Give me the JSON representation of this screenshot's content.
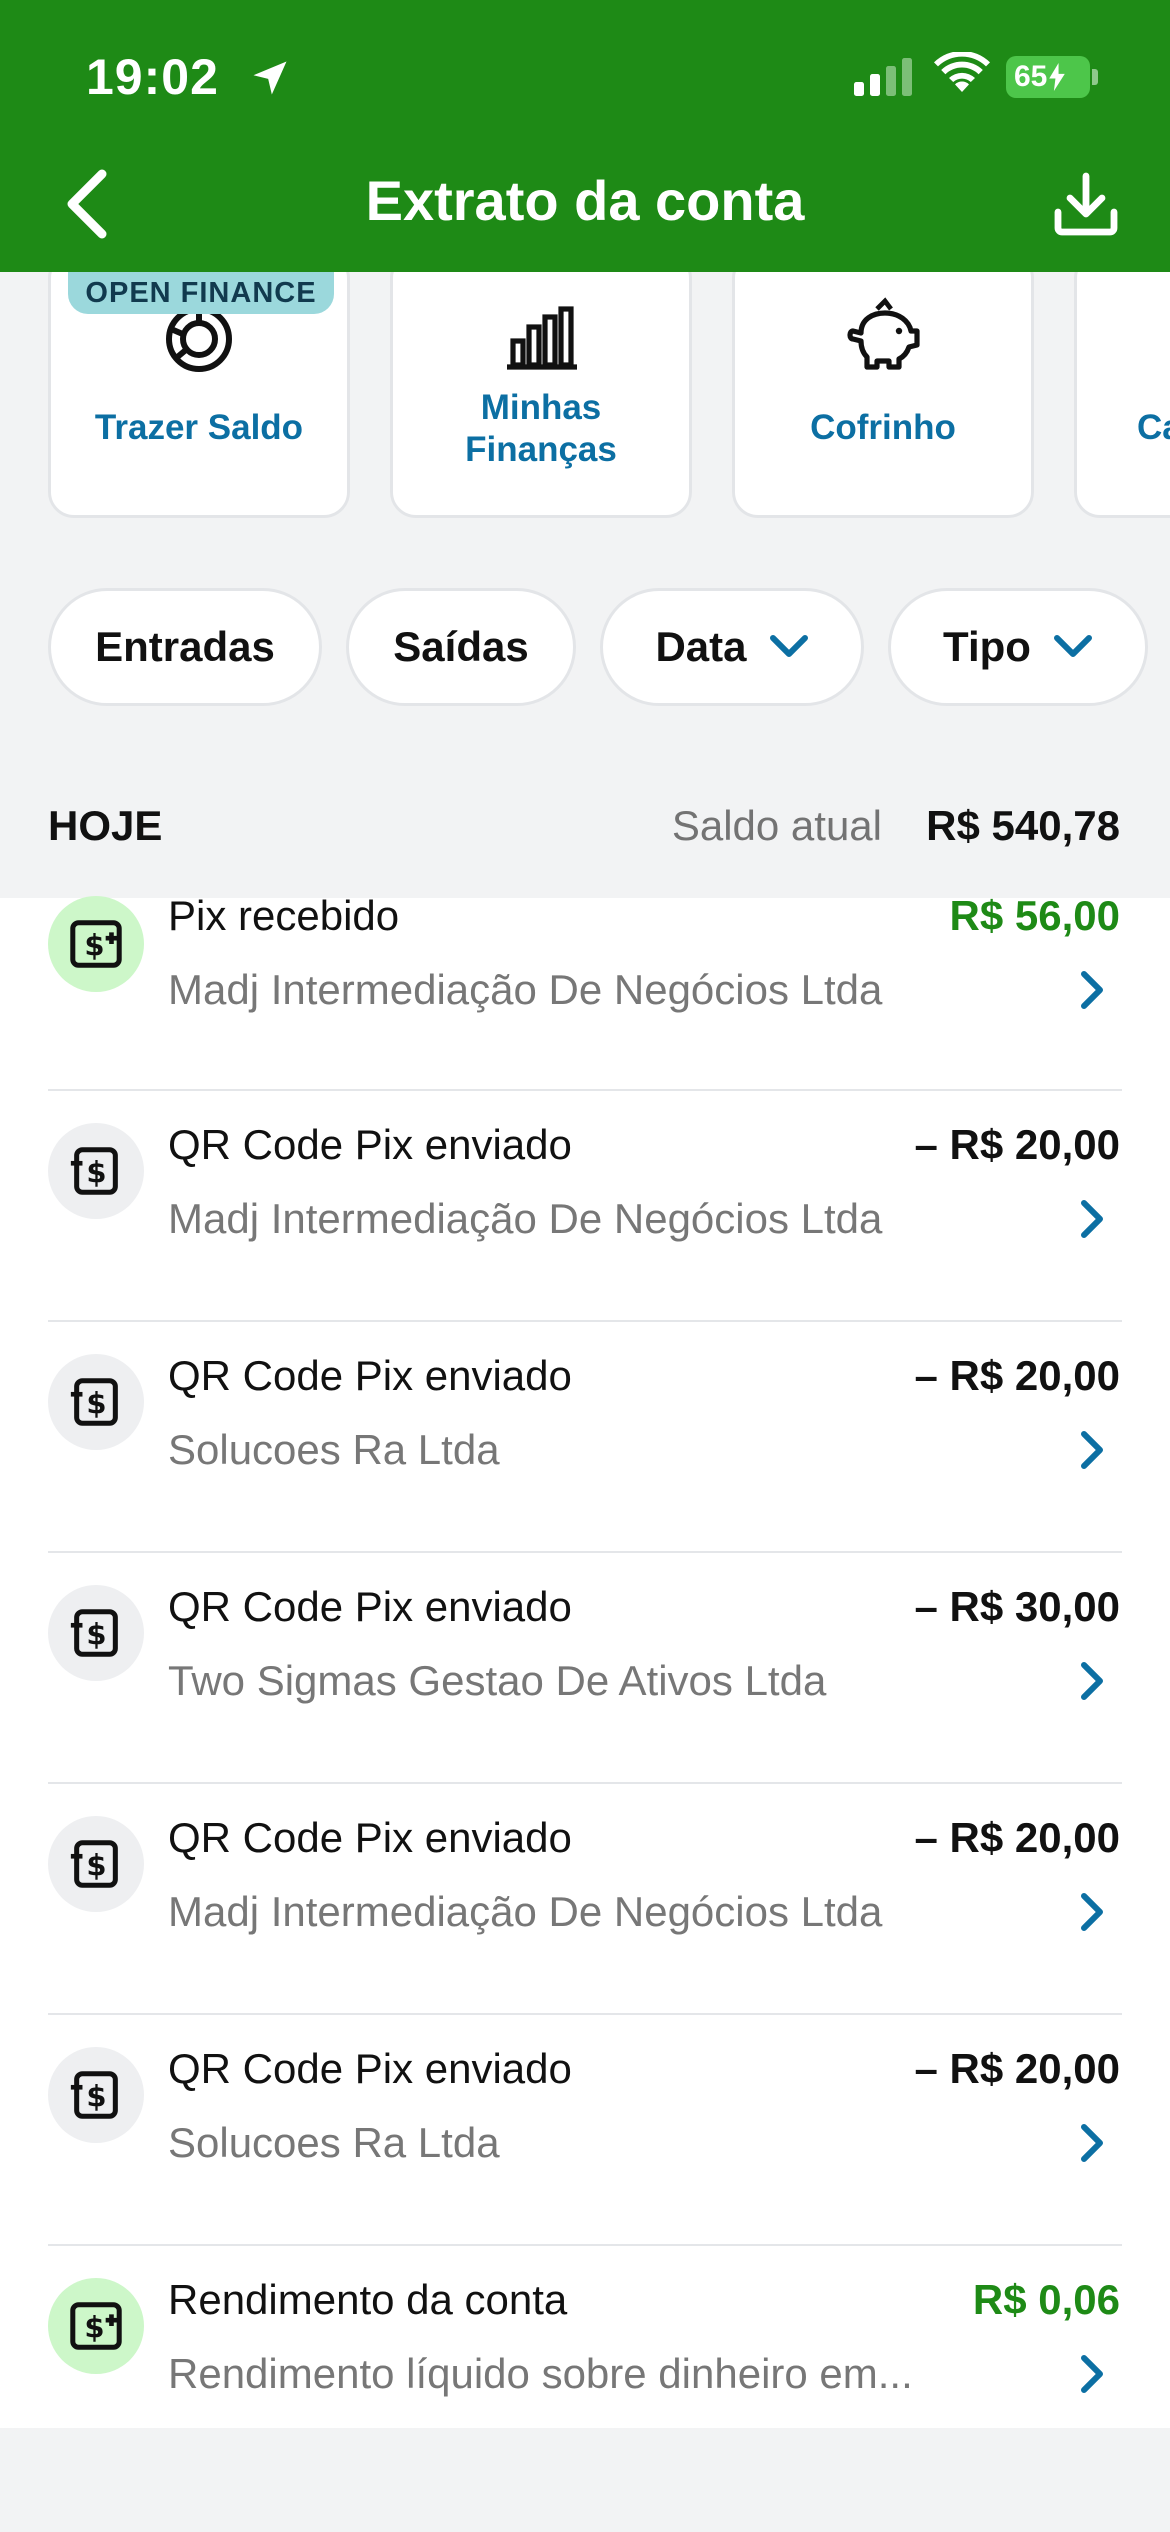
{
  "status_bar": {
    "time": "19:02",
    "battery": "65"
  },
  "header": {
    "title": "Extrato da conta"
  },
  "cards": [
    {
      "label": "Trazer Saldo",
      "badge": "OPEN FINANCE",
      "icon": "pie-chart-icon"
    },
    {
      "label_line1": "Minhas",
      "label_line2": "Finanças",
      "icon": "bar-chart-icon"
    },
    {
      "label": "Cofrinho",
      "icon": "piggy-bank-icon"
    },
    {
      "label": "Ca",
      "icon": ""
    }
  ],
  "filters": [
    {
      "label": "Entradas"
    },
    {
      "label": "Saídas"
    },
    {
      "label": "Data"
    },
    {
      "label": "Tipo"
    }
  ],
  "section": {
    "title": "HOJE",
    "balance_label": "Saldo atual",
    "balance_value": "R$ 540,78"
  },
  "transactions": [
    {
      "title": "Pix recebido",
      "subtitle": "Madj Intermediação De Negócios Ltda",
      "amount": "R$ 56,00",
      "direction": "in"
    },
    {
      "title": "QR Code Pix enviado",
      "subtitle": "Madj Intermediação De Negócios Ltda",
      "amount": "– R$ 20,00",
      "direction": "out"
    },
    {
      "title": "QR Code Pix enviado",
      "subtitle": "Solucoes Ra Ltda",
      "amount": "– R$ 20,00",
      "direction": "out"
    },
    {
      "title": "QR Code Pix enviado",
      "subtitle": "Two Sigmas Gestao De Ativos Ltda",
      "amount": "– R$ 30,00",
      "direction": "out"
    },
    {
      "title": "QR Code Pix enviado",
      "subtitle": "Madj Intermediação De Negócios Ltda",
      "amount": "– R$ 20,00",
      "direction": "out"
    },
    {
      "title": "QR Code Pix enviado",
      "subtitle": "Solucoes Ra Ltda",
      "amount": "– R$ 20,00",
      "direction": "out"
    },
    {
      "title": "Rendimento da conta",
      "subtitle": "Rendimento líquido sobre dinheiro em...",
      "amount": "R$ 0,06",
      "direction": "in"
    }
  ],
  "colors": {
    "brand_green": "#1e8a16",
    "link_blue": "#0c6fa3",
    "positive_green": "#1e8a16",
    "badge_teal": "#9bd8dc"
  }
}
